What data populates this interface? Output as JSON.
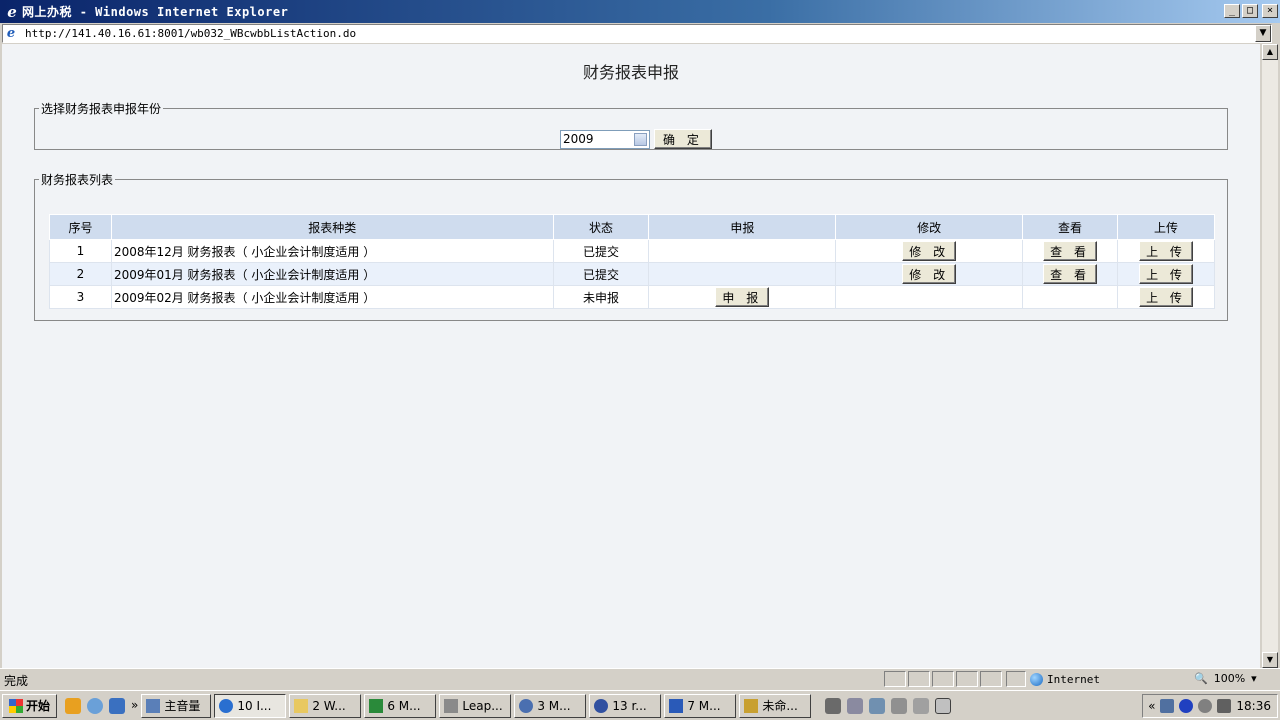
{
  "window": {
    "title": "网上办税 - Windows Internet Explorer",
    "address": "http://141.40.16.61:8001/wb032_WBcwbbListAction.do"
  },
  "page": {
    "title": "财务报表申报",
    "year_section": {
      "legend": "选择财务报表申报年份",
      "year_value": "2009",
      "confirm_label": "确 定"
    },
    "list_section": {
      "legend": "财务报表列表",
      "columns": [
        "序号",
        "报表种类",
        "状态",
        "申报",
        "修改",
        "查看",
        "上传"
      ],
      "rows": [
        {
          "no": "1",
          "type": "2008年12月 财务报表（ 小企业会计制度适用 ）",
          "status": "已提交",
          "declare": "",
          "modify": "修 改",
          "view": "查 看",
          "upload": "上 传"
        },
        {
          "no": "2",
          "type": "2009年01月 财务报表（ 小企业会计制度适用 ）",
          "status": "已提交",
          "declare": "",
          "modify": "修 改",
          "view": "查 看",
          "upload": "上 传"
        },
        {
          "no": "3",
          "type": "2009年02月 财务报表（ 小企业会计制度适用 ）",
          "status": "未申报",
          "declare": "申 报",
          "modify": "",
          "view": "",
          "upload": "上 传"
        }
      ]
    }
  },
  "statusbar": {
    "text": "完成",
    "zone": "Internet",
    "zoom": "100%"
  },
  "taskbar": {
    "start_label": "开始",
    "overflow": "»",
    "tasks": [
      {
        "label": "主音量"
      },
      {
        "label": "10 I..."
      },
      {
        "label": "2 W..."
      },
      {
        "label": "6 M..."
      },
      {
        "label": "Leap..."
      },
      {
        "label": "3 M..."
      },
      {
        "label": "13 r..."
      },
      {
        "label": "7 M..."
      },
      {
        "label": "未命..."
      }
    ],
    "tray_collapse": "«",
    "clock": "18:36"
  }
}
